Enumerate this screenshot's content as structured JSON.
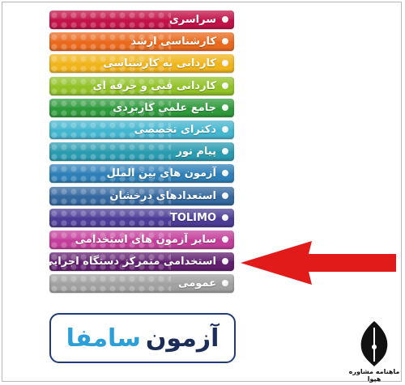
{
  "menu": {
    "items": [
      {
        "label": "سراسری",
        "color": "#c2134a"
      },
      {
        "label": "کارشناسی ارشد",
        "color": "#e96a1e"
      },
      {
        "label": "کاردانی به کارشناسی",
        "color": "#f1b51c"
      },
      {
        "label": "کاردانی فنی و حرفه ای",
        "color": "#92c227"
      },
      {
        "label": "جامع علمی کاربردی",
        "color": "#2e9a3c"
      },
      {
        "label": "دکترای تخصصی",
        "color": "#44b6cf"
      },
      {
        "label": "پیام نور",
        "color": "#2b9bb0"
      },
      {
        "label": "آزمون های بین الملل",
        "color": "#2f80b8"
      },
      {
        "label": "استعدادهای درخشان",
        "color": "#34689f"
      },
      {
        "label": "TOLIMO",
        "color": "#4d3d97"
      },
      {
        "label": "سایر آزمون های استخدامی",
        "color": "#c43f9c"
      },
      {
        "label": "استخدامی متمرکز دستگاه اجرایی",
        "color": "#61206f"
      },
      {
        "label": "عمومی",
        "color": "#a1a1a1"
      }
    ]
  },
  "logo": {
    "text_dark": "آزمون",
    "text_light": "سامفا"
  },
  "brand": {
    "name": "ماهنامه مشاوره هپوا"
  },
  "colors": {
    "arrow": "#e11a1a",
    "logo_border": "#1f3b7a"
  }
}
